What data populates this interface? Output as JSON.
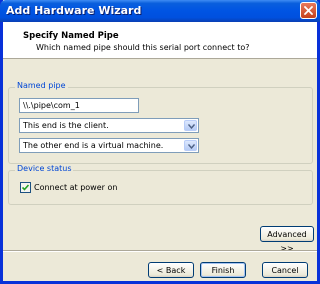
{
  "window": {
    "title": "Add Hardware Wizard",
    "close_icon": "close-icon"
  },
  "header": {
    "title": "Specify Named Pipe",
    "subtitle": "Which named pipe should this serial port connect to?"
  },
  "named_pipe": {
    "legend": "Named pipe",
    "pipe_path": "\\\\.\\pipe\\com_1",
    "this_end": "This end is the client.",
    "other_end": "The other end is a virtual machine."
  },
  "device_status": {
    "legend": "Device status",
    "connect_label": "Connect at power on",
    "connect_checked": true
  },
  "buttons": {
    "advanced": "Advanced >>",
    "back": "< Back",
    "finish": "Finish",
    "cancel": "Cancel"
  },
  "colors": {
    "title_bar": "#0054e3",
    "close_button": "#c5411c",
    "group_legend": "#0046d5",
    "dialog_background": "#ece9d8"
  }
}
